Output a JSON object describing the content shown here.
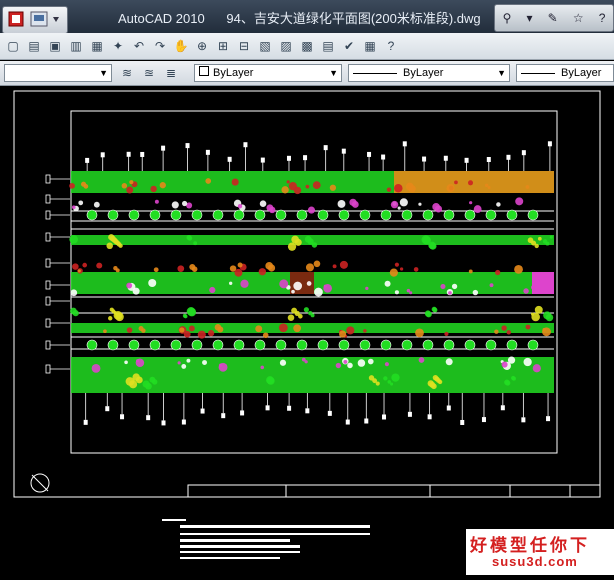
{
  "window": {
    "app_name": "AutoCAD 2010",
    "file_name": "94、吉安大道绿化平面图(200米标准段).dwg"
  },
  "properties_toolbar": {
    "color_value": "ByLayer",
    "linetype_value": "ByLayer",
    "lineweight_value": "ByLayer"
  },
  "watermark": {
    "chinese": "好模型任你下",
    "site": "susu3d.com"
  },
  "colors": {
    "green": "#22dd22",
    "orange": "#e6881a",
    "magenta": "#dd44cc",
    "red": "#cc2222",
    "cyan": "#44dddd",
    "yellow": "#e0e020"
  }
}
